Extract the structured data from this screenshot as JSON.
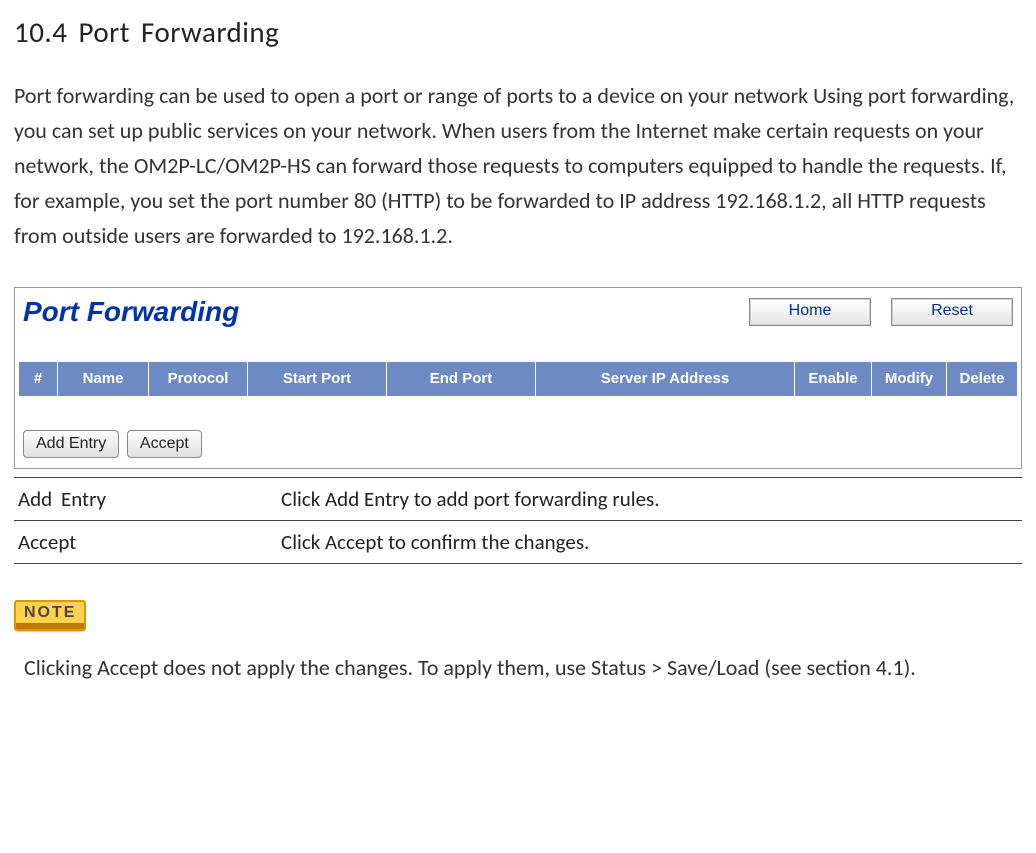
{
  "heading": "10.4  Port  Forwarding",
  "intro": "Port forwarding can be used to open a port or range of ports to a device on your network Using port forwarding, you can set up public services on your network. When users from the Internet make certain requests on your network, the OM2P-LC/OM2P-HS can forward those requests to computers equipped to handle the requests. If, for example, you set the port number 80 (HTTP) to be forwarded to IP address 192.168.1.2, all HTTP requests from outside users are forwarded to 192.168.1.2.",
  "panel": {
    "title": "Port Forwarding",
    "top_buttons": {
      "home": "Home",
      "reset": "Reset"
    },
    "columns": {
      "num": "#",
      "name": "Name",
      "protocol": "Protocol",
      "start": "Start Port",
      "end": "End Port",
      "ip": "Server IP Address",
      "enable": "Enable",
      "modify": "Modify",
      "delete": "Delete"
    },
    "actions": {
      "add": "Add Entry",
      "accept": "Accept"
    }
  },
  "defs": {
    "add_k": "Add Entry",
    "add_v_prefix": "Click ",
    "add_v_term": "Add Entry",
    "add_v_suffix": " to add port forwarding rules.",
    "accept_k": "Accept",
    "accept_v_prefix": "Click ",
    "accept_v_term": "Accept",
    "accept_v_suffix": " to confirm the changes."
  },
  "note_label": "NOTE",
  "note": {
    "p1": "Clicking ",
    "p2": "Accept",
    "p3": " does not apply the changes. To apply them, use ",
    "p4": "Status",
    "p5": " > ",
    "p6": "Save/Load",
    "p7": "  (see section 4.1)."
  }
}
